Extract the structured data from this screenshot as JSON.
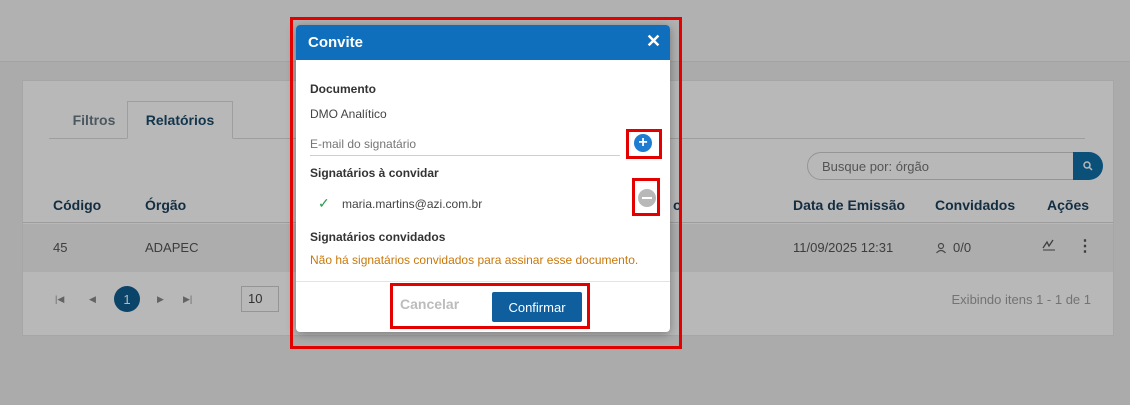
{
  "tabs": {
    "filtros": "Filtros",
    "relatorios": "Relatórios"
  },
  "search": {
    "placeholder": "Busque por: órgão"
  },
  "table": {
    "headers": {
      "codigo": "Código",
      "orgao": "Órgão",
      "hidden_fragment": "o",
      "data": "Data de Emissão",
      "convidados": "Convidados",
      "acoes": "Ações"
    },
    "rows": [
      {
        "codigo": "45",
        "orgao": "ADAPEC",
        "data": "11/09/2025 12:31",
        "convidados": "0/0"
      }
    ]
  },
  "pager": {
    "current_page": "1",
    "page_size": "10",
    "info": "Exibindo itens 1 - 1 de 1"
  },
  "modal": {
    "title": "Convite",
    "close": "✕",
    "documento_label": "Documento",
    "documento_value": "DMO Analítico",
    "email_placeholder": "E-mail do signatário",
    "add_icon": "+",
    "a_convidar_label": "Signatários à convidar",
    "signers": [
      {
        "email": "maria.martins@azi.com.br"
      }
    ],
    "convidados_label": "Signatários convidados",
    "convidados_empty": "Não há signatários convidados para assinar esse documento.",
    "cancel_label": "Cancelar",
    "confirm_label": "Confirmar"
  },
  "colors": {
    "header_blue": "#0f6fbc",
    "highlight_red": "#e50000",
    "warning_orange": "#c9780a",
    "brand_dark": "#0f5f9e"
  }
}
